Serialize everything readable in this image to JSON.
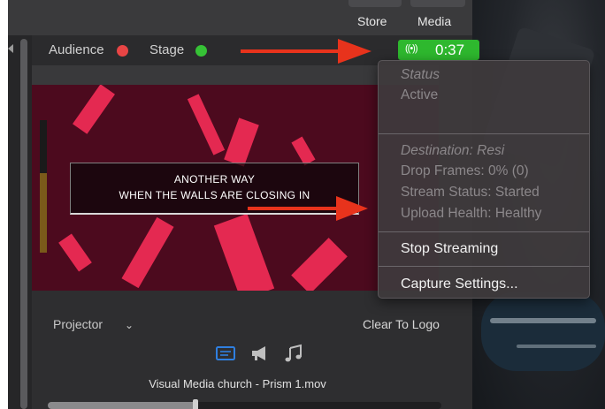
{
  "toolbar": {
    "store_label": "Store",
    "media_label": "Media"
  },
  "statusbar": {
    "audience_label": "Audience",
    "stage_label": "Stage",
    "audience_color": "#e84545",
    "stage_color": "#36c236",
    "stream_icon": "((•))",
    "stream_time": "0:37",
    "stream_badge_color": "#2eb82e"
  },
  "preview": {
    "lyric_line1": "ANOTHER WAY",
    "lyric_line2": "WHEN THE WALLS ARE CLOSING IN"
  },
  "footer": {
    "projector_label": "Projector",
    "projector_chevron": "⌄",
    "clear_to_logo_label": "Clear To Logo",
    "media_title": "Visual Media church - Prism 1.mov"
  },
  "icons": {
    "slides_tab": "slides-icon",
    "announcements_tab": "megaphone-icon",
    "audio_tab": "music-note-icon"
  },
  "accent_color": "#2f7fe0",
  "stream_menu": {
    "status_heading": "Status",
    "status_value": "Active",
    "destination": "Destination: Resi",
    "drop_frames": "Drop Frames: 0% (0)",
    "stream_status": "Stream Status: Started",
    "upload_health": "Upload Health: Healthy",
    "stop_streaming": "Stop Streaming",
    "capture_settings": "Capture Settings..."
  },
  "annotation_color": "#e8331c"
}
